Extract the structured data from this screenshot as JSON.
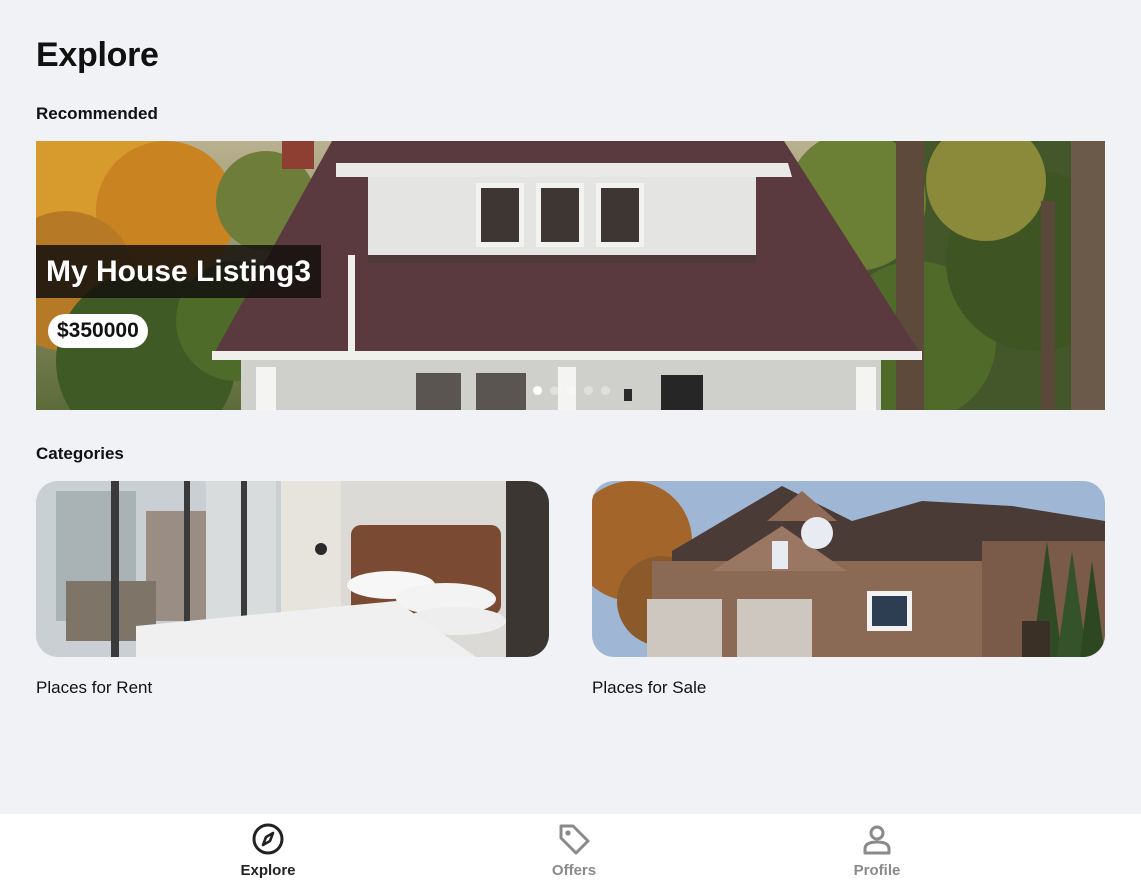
{
  "page": {
    "title": "Explore"
  },
  "sections": {
    "recommended": "Recommended",
    "categories": "Categories"
  },
  "carousel": {
    "listing_title": "My House Listing3",
    "price": "$350000",
    "slide_count": 5,
    "active_slide": 1
  },
  "categories": [
    {
      "label": "Places for Rent",
      "image": "bedroom-photo"
    },
    {
      "label": "Places for Sale",
      "image": "house-exterior-photo"
    }
  ],
  "bottom_nav": [
    {
      "label": "Explore",
      "icon": "compass-icon",
      "active": true
    },
    {
      "label": "Offers",
      "icon": "tag-icon",
      "active": false
    },
    {
      "label": "Profile",
      "icon": "user-icon",
      "active": false
    }
  ],
  "colors": {
    "background": "#f1f2f6",
    "active_nav": "#222222",
    "inactive_nav": "#8a8a8a"
  }
}
